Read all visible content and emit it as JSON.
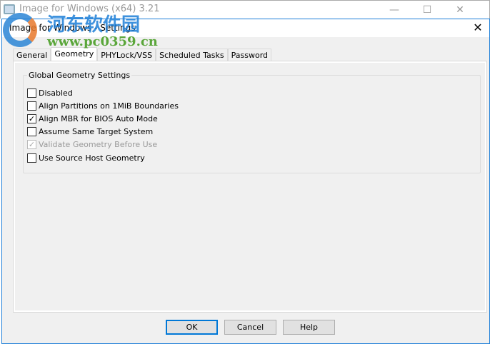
{
  "outer_window": {
    "title": "Image for Windows (x64) 3.21",
    "minimize": "—",
    "maximize": "☐",
    "close": "✕"
  },
  "dialog": {
    "title": "Image for Windows - Settings",
    "close": "✕"
  },
  "tabs": [
    {
      "label": "General"
    },
    {
      "label": "Geometry"
    },
    {
      "label": "PHYLock/VSS"
    },
    {
      "label": "Scheduled Tasks"
    },
    {
      "label": "Password"
    }
  ],
  "active_tab": "Geometry",
  "group": {
    "title": "Global Geometry Settings",
    "options": [
      {
        "label": "Disabled",
        "checked": false,
        "enabled": true
      },
      {
        "label": "Align Partitions on 1MiB Boundaries",
        "checked": false,
        "enabled": true
      },
      {
        "label": "Align MBR for BIOS Auto Mode",
        "checked": true,
        "enabled": true
      },
      {
        "label": "Assume Same Target System",
        "checked": false,
        "enabled": true
      },
      {
        "label": "Validate Geometry Before Use",
        "checked": true,
        "enabled": false
      },
      {
        "label": "Use Source Host Geometry",
        "checked": false,
        "enabled": true
      }
    ]
  },
  "buttons": {
    "ok": "OK",
    "cancel": "Cancel",
    "help": "Help"
  },
  "watermark": {
    "name": "河东软件园",
    "url": "www.pc0359.cn"
  },
  "check_mark": "✓"
}
